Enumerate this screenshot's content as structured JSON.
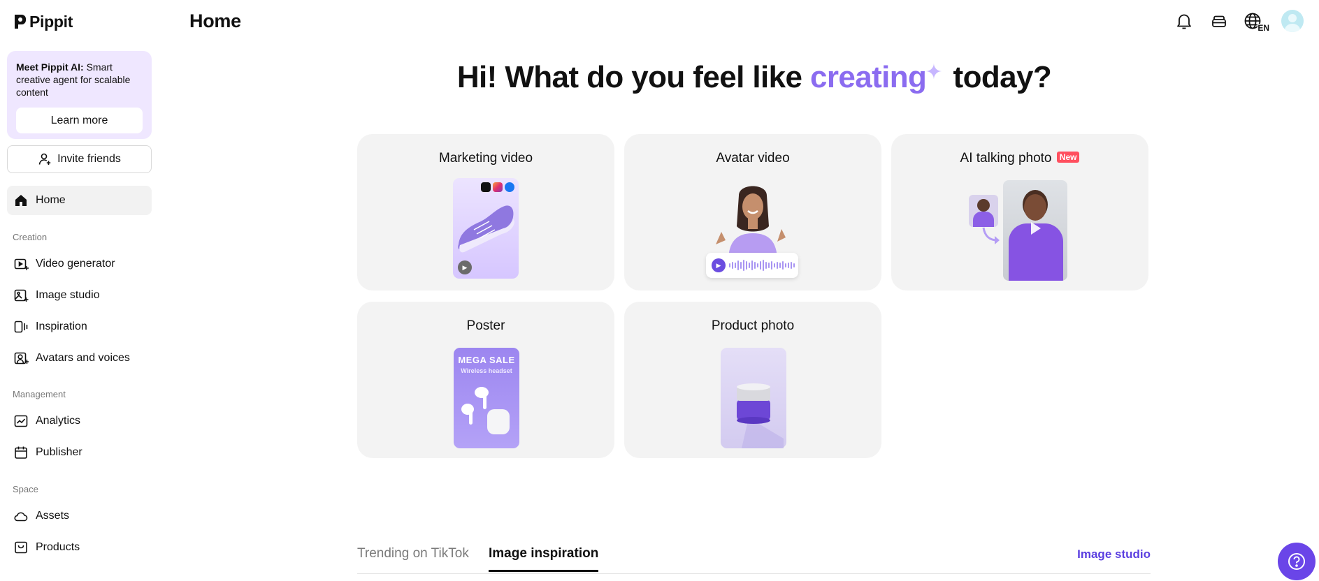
{
  "app": {
    "name": "Pippit"
  },
  "sidebar": {
    "promo": {
      "title_bold": "Meet Pippit AI:",
      "title_rest": " Smart creative agent for scalable content",
      "button": "Learn more"
    },
    "invite": "Invite friends",
    "home": "Home",
    "sections": {
      "creation": "Creation",
      "management": "Management",
      "space": "Space"
    },
    "creation_items": [
      "Video generator",
      "Image studio",
      "Inspiration",
      "Avatars and voices"
    ],
    "management_items": [
      "Analytics",
      "Publisher"
    ],
    "space_items": [
      "Assets",
      "Products"
    ]
  },
  "header": {
    "title": "Home",
    "language": "EN"
  },
  "hero": {
    "prefix": "Hi! What do you feel like ",
    "accent": "creating",
    "sparkle": "✦",
    "suffix": " today?"
  },
  "cards": [
    {
      "title": "Marketing video"
    },
    {
      "title": "Avatar video"
    },
    {
      "title": "AI talking photo",
      "badge": "New"
    },
    {
      "title": "Poster",
      "poster_headline": "MEGA SALE",
      "poster_sub": "Wireless headset"
    },
    {
      "title": "Product photo"
    }
  ],
  "tabs": {
    "items": [
      "Trending on TikTok",
      "Image inspiration"
    ],
    "active": "Image inspiration",
    "link": "Image studio"
  },
  "colors": {
    "accent": "#8b6cf0",
    "brand_purple": "#6a45e8",
    "promo_bg": "#efe7ff",
    "badge_red": "#ff4f5e"
  },
  "icons": {
    "notifications": "bell-icon",
    "credits": "stack-icon",
    "language": "globe-icon",
    "help": "question-icon"
  }
}
